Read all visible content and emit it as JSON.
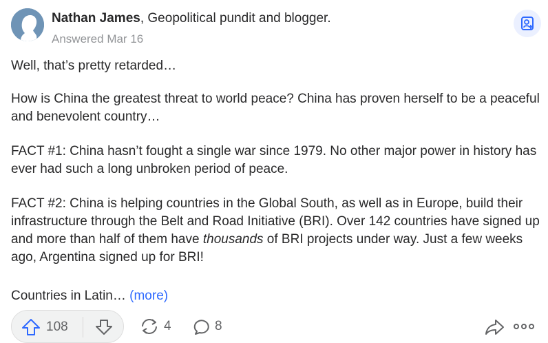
{
  "author": {
    "name": "Nathan James",
    "credential": ", Geopolitical pundit and blogger.",
    "answered": "Answered Mar 16"
  },
  "answer": {
    "p1": "Well, that’s pretty retarded…",
    "p2": "How is China the greatest threat to world peace? China has proven herself to be a peaceful and benevolent country…",
    "p3": "FACT #1: China hasn’t fought a single war since 1979. No other major power in history has ever had such a long unbroken period of peace.",
    "p4_before": "FACT #2: China is helping countries in the Global South, as well as in Europe, build their infrastructure through the Belt and Road Initiative (BRI). Over 142 countries have signed up and more than half of them have ",
    "p4_emphasis": "thousands",
    "p4_after": " of BRI projects under way. Just a few weeks ago, Argentina signed up for BRI!",
    "p5": "Countries in Latin… ",
    "more_label": "(more)"
  },
  "actions": {
    "upvotes": "108",
    "shares": "4",
    "comments": "8"
  },
  "icons": {
    "follow": "add-person-icon",
    "upvote": "upvote-arrow-icon",
    "downvote": "downvote-arrow-icon",
    "share": "reshare-icon",
    "comment": "comment-bubble-icon",
    "forward": "forward-arrow-icon",
    "overflow": "more-options-icon"
  },
  "colors": {
    "accent": "#2e69ff",
    "text": "#282829",
    "muted": "#939598",
    "icon": "#636466"
  }
}
